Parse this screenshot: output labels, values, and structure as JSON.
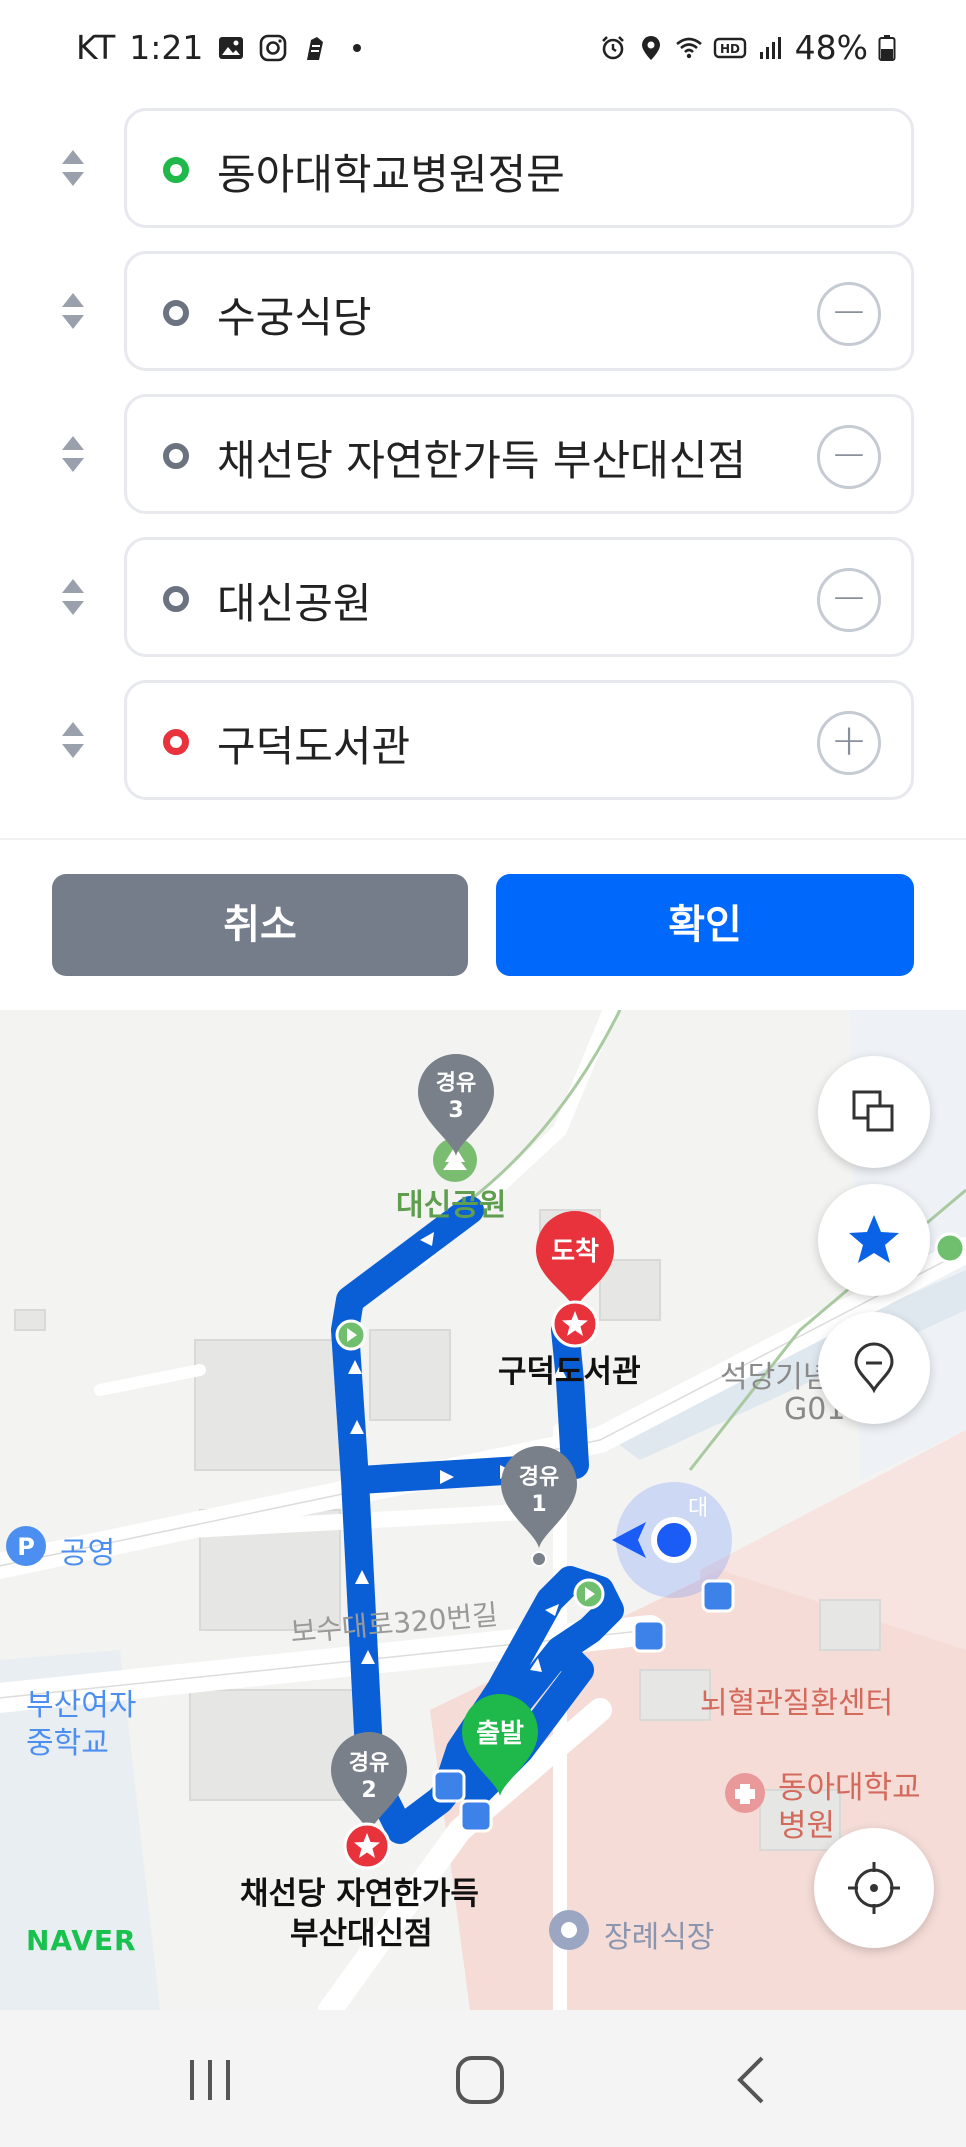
{
  "status_bar": {
    "carrier": "KT",
    "time": "1:21",
    "battery": "48%",
    "icons": [
      "image-icon",
      "instagram-icon",
      "app-icon",
      "dot-icon",
      "alarm-icon",
      "location-icon",
      "wifi-icon",
      "hd-icon",
      "signal-icon",
      "battery-icon"
    ]
  },
  "waypoints": [
    {
      "label": "동아대학교병원정문",
      "type": "start",
      "dot_color": "#1fb84a",
      "action": ""
    },
    {
      "label": "수궁식당",
      "type": "via",
      "dot_color": "#6b7280",
      "action": "−"
    },
    {
      "label": "채선당 자연한가득 부산대신점",
      "type": "via",
      "dot_color": "#6b7280",
      "action": "−"
    },
    {
      "label": "대신공원",
      "type": "via",
      "dot_color": "#6b7280",
      "action": "−"
    },
    {
      "label": "구덕도서관",
      "type": "end",
      "dot_color": "#e8323c",
      "action": "+"
    }
  ],
  "buttons": {
    "cancel": "취소",
    "confirm": "확인"
  },
  "map": {
    "markers": {
      "via3": {
        "title": "경유",
        "num": "3"
      },
      "via1": {
        "title": "경유",
        "num": "1"
      },
      "via2": {
        "title": "경유",
        "num": "2"
      },
      "arrive": "도착",
      "depart": "출발"
    },
    "labels": {
      "park": "대신공원",
      "library": "구덕도서관",
      "seokdang": "석당기념",
      "g01": "G01",
      "gongyeong": "공영",
      "road": "보수대로320번길",
      "school_line1": "부산여자",
      "school_line2": "중학교",
      "stroke_center": "뇌혈관질환센터",
      "hospital_line1": "동아대학교",
      "hospital_line2": "병원",
      "funeral": "장례식장",
      "restaurant_line1": "채선당 자연한가득",
      "restaurant_line2": "부산대신점",
      "naver": "NAVER",
      "road_fragment": "대"
    },
    "route_color": "#0a5fd6",
    "controls": [
      "layers-icon",
      "star-icon",
      "pin-icon",
      "locate-icon"
    ]
  },
  "nav": [
    "recents-icon",
    "home-icon",
    "back-icon"
  ]
}
